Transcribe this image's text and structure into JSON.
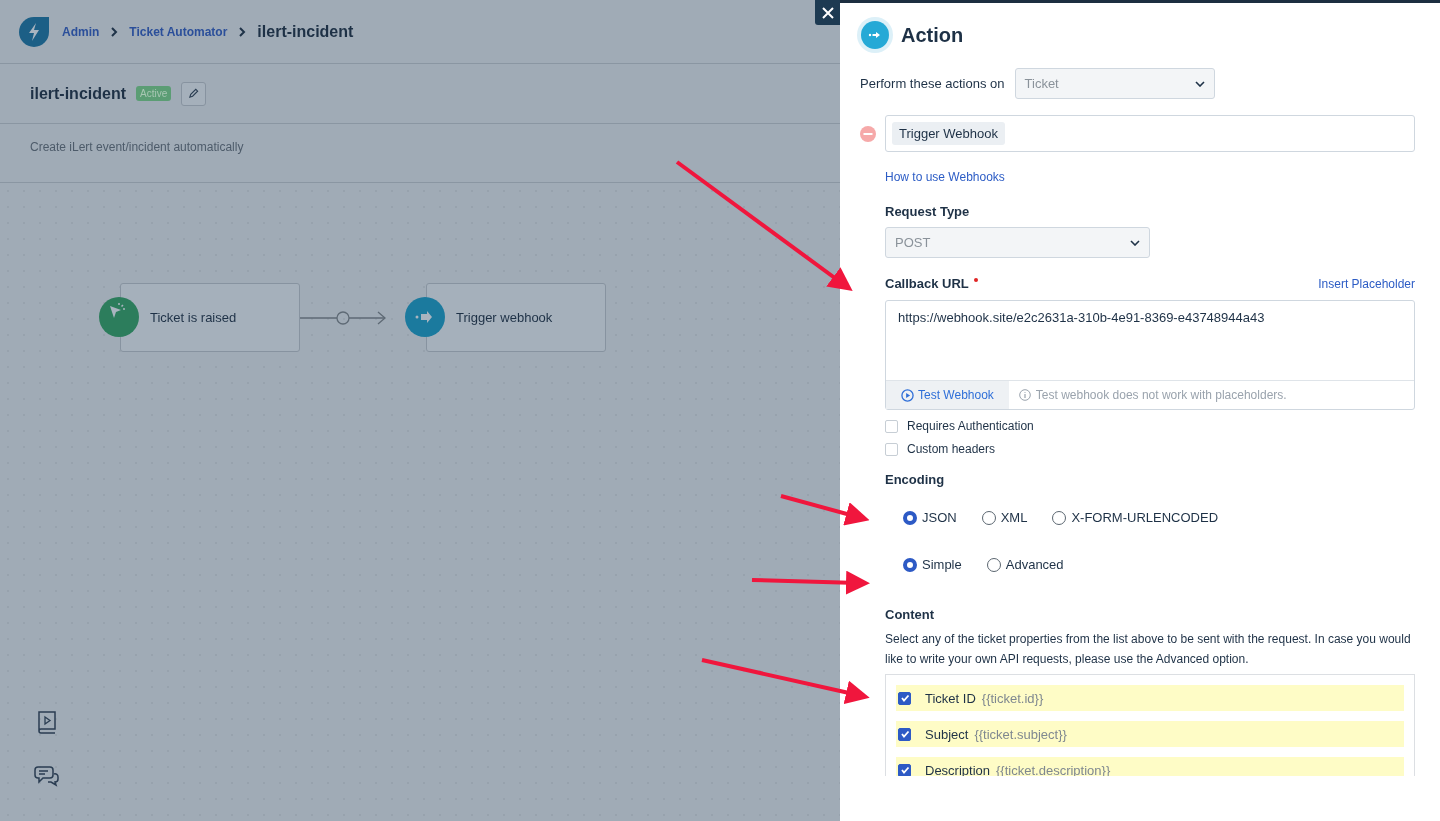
{
  "breadcrumb": [
    {
      "label": "Admin",
      "link": true
    },
    {
      "label": "Ticket Automator",
      "link": true
    },
    {
      "label": "ilert-incident",
      "link": false
    }
  ],
  "rule": {
    "name": "ilert-incident",
    "status": "Active",
    "description": "Create iLert event/incident automatically"
  },
  "workflow": {
    "nodes": [
      {
        "kind": "trigger",
        "label": "Ticket is raised"
      },
      {
        "kind": "action",
        "label": "Trigger webhook"
      }
    ]
  },
  "panel": {
    "title": "Action",
    "perform_label": "Perform these actions on",
    "perform_value": "Ticket",
    "action_tag": "Trigger Webhook",
    "help_link": "How to use Webhooks",
    "request_type": {
      "label": "Request Type",
      "value": "POST"
    },
    "callback": {
      "label": "Callback URL",
      "required": true,
      "insert_link": "Insert Placeholder",
      "value": "https://webhook.site/e2c2631a-310b-4e91-8369-e43748944a43",
      "test_button": "Test Webhook",
      "test_note": "Test webhook does not work with placeholders."
    },
    "options": [
      {
        "label": "Requires Authentication",
        "checked": false
      },
      {
        "label": "Custom headers",
        "checked": false
      }
    ],
    "encoding": {
      "label": "Encoding",
      "options": [
        {
          "label": "JSON",
          "selected": true
        },
        {
          "label": "XML",
          "selected": false
        },
        {
          "label": "X-FORM-URLENCODED",
          "selected": false
        }
      ]
    },
    "mode": {
      "options": [
        {
          "label": "Simple",
          "selected": true
        },
        {
          "label": "Advanced",
          "selected": false
        }
      ]
    },
    "content": {
      "label": "Content",
      "hint": "Select any of the ticket properties from the list above to be sent with the request. In case you would like to write your own API requests, please use the Advanced option.",
      "fields": [
        {
          "label": "Ticket ID",
          "placeholder": "{{ticket.id}}",
          "checked": true
        },
        {
          "label": "Subject",
          "placeholder": "{{ticket.subject}}",
          "checked": true
        },
        {
          "label": "Description",
          "placeholder": "{{ticket.description}}",
          "checked": true
        }
      ]
    }
  }
}
